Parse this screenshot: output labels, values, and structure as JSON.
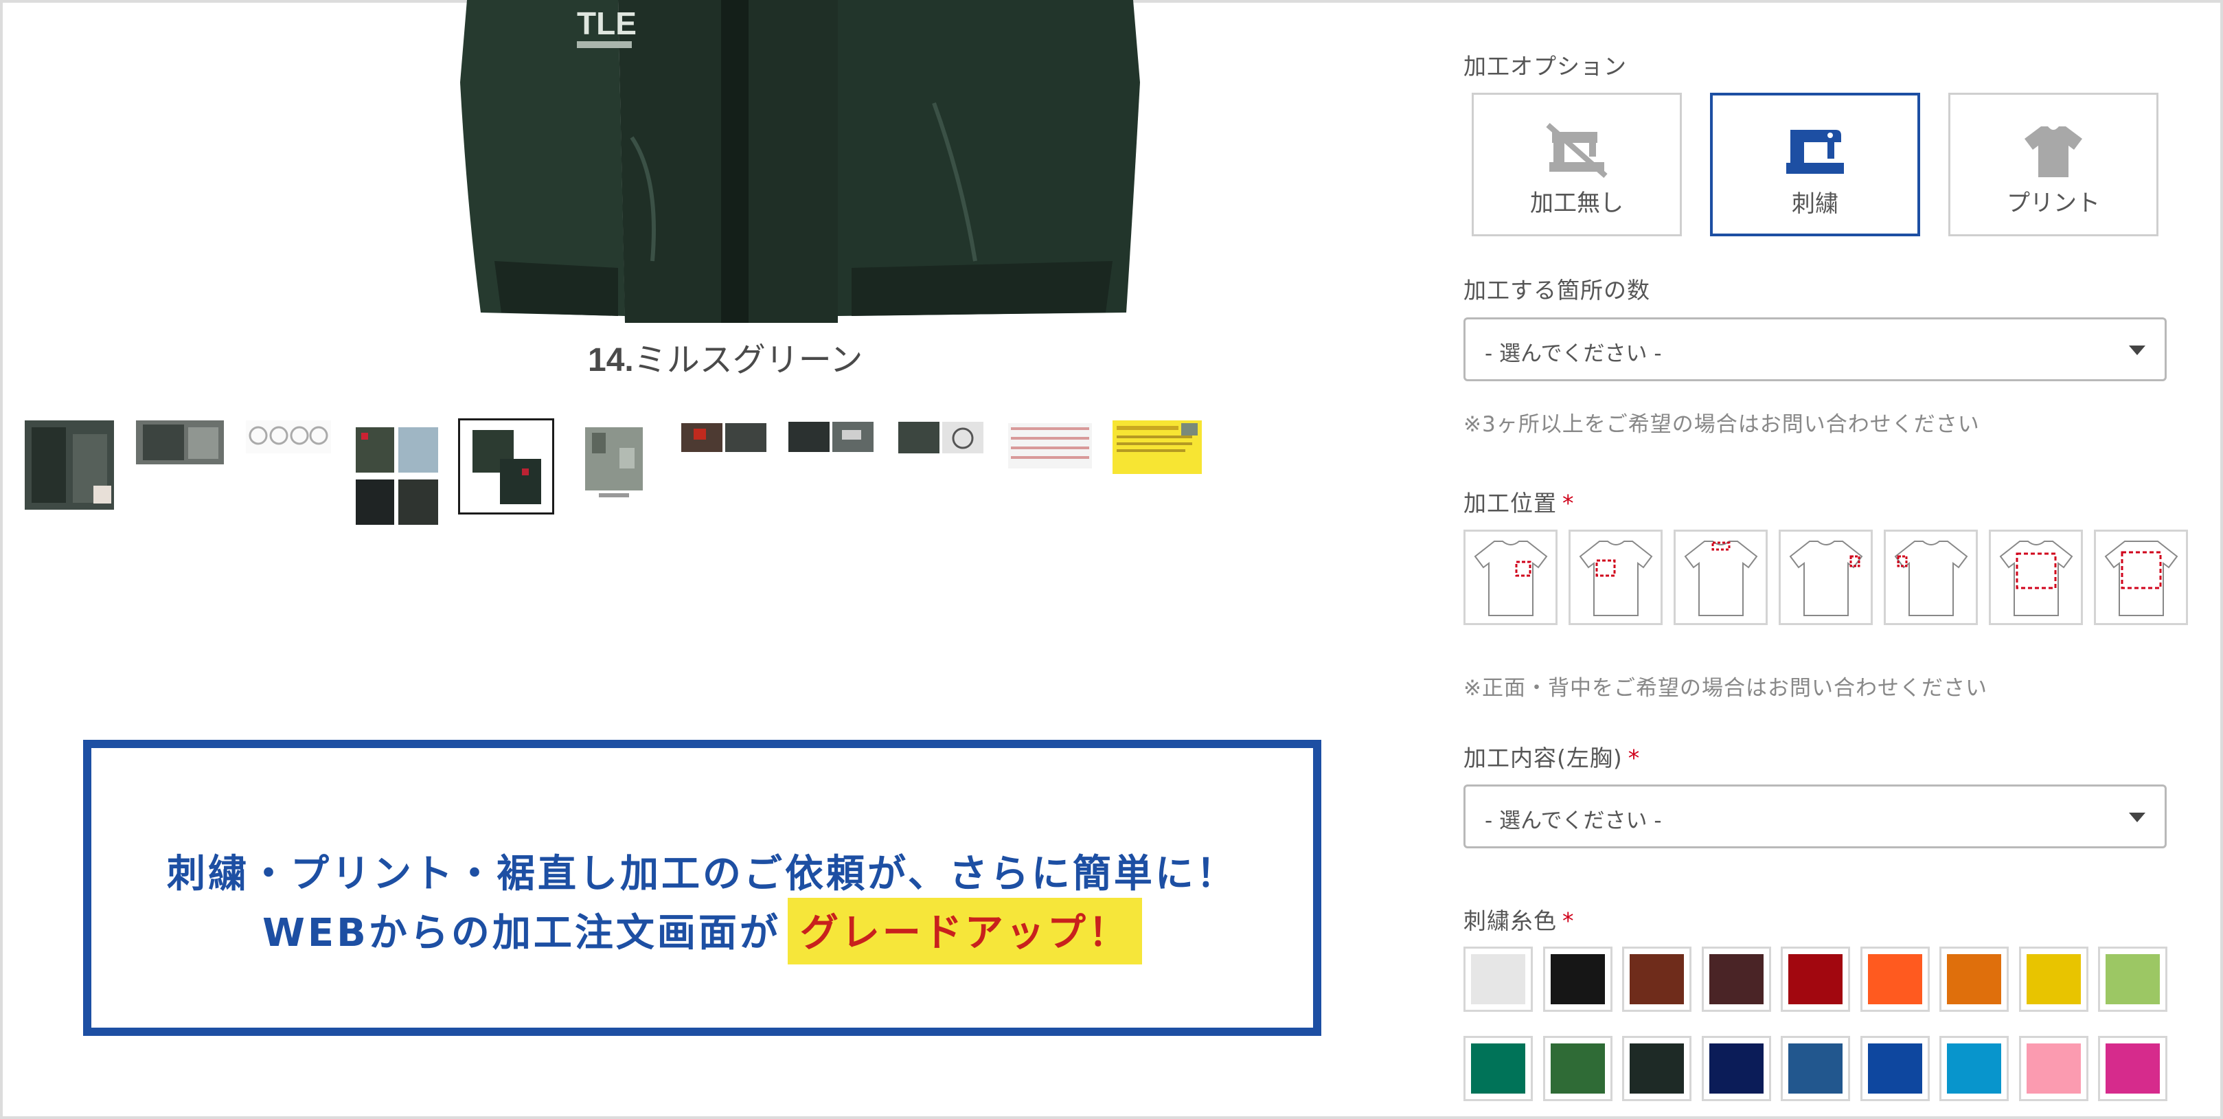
{
  "product": {
    "color_caption_number": "14.",
    "color_caption_name": "ミルスグリーン",
    "jacket_print": "TLE"
  },
  "banner": {
    "line1": "刺繍・プリント・裾直し加工のご依頼が、さらに簡単に！",
    "line2": "WEBからの加工注文画面が",
    "highlight": "グレードアップ！"
  },
  "options": {
    "heading": "加工オプション",
    "buttons": [
      {
        "label": "加工無し",
        "icon": "no-sewing-machine-icon",
        "active": false
      },
      {
        "label": "刺繍",
        "icon": "sewing-machine-icon",
        "active": true
      },
      {
        "label": "プリント",
        "icon": "tshirt-icon",
        "active": false
      }
    ]
  },
  "count": {
    "heading": "加工する箇所の数",
    "select_value": "- 選んでください -",
    "note": "※3ヶ所以上をご希望の場合はお問い合わせください"
  },
  "position": {
    "heading": "加工位置",
    "required_mark": "*",
    "note": "※正面・背中をご希望の場合はお問い合わせください"
  },
  "content": {
    "heading": "加工内容(左胸)",
    "required_mark": "*",
    "select_value": "- 選んでください -"
  },
  "thread": {
    "heading": "刺繍糸色",
    "required_mark": "*",
    "colors": [
      "#e6e6e6",
      "#161616",
      "#6f2c1b",
      "#4a2426",
      "#a2070f",
      "#ff5a1f",
      "#df6f0c",
      "#e8c400",
      "#9cc764",
      "#007358",
      "#2f6b36",
      "#1e2a26",
      "#0b1c58",
      "#22578e",
      "#0e479f",
      "#0895cc",
      "#fb9bb0",
      "#d62b8c"
    ]
  },
  "colors": {
    "accent": "#1d4fa3",
    "highlight_bg": "#f6e63a",
    "highlight_text": "#c8211d",
    "required": "#d0021b"
  }
}
